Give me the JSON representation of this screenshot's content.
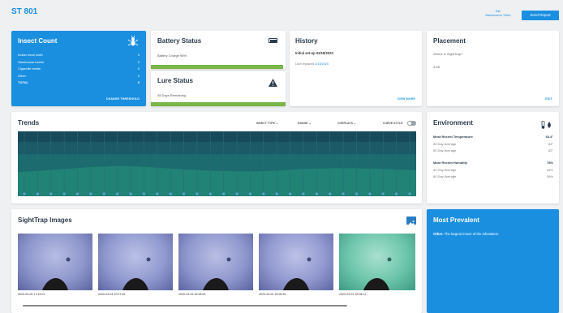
{
  "header": {
    "title": "ST 801",
    "edit_label": "Edit\nMaintenance Ticket",
    "report_label": "Send Report"
  },
  "insect_count": {
    "title": "Insect Count",
    "rows": [
      {
        "label": "Indian meal moth",
        "value": "0"
      },
      {
        "label": "Warehouse beetle",
        "value": "0"
      },
      {
        "label": "Cigarette beetle",
        "value": "0"
      },
      {
        "label": "Other",
        "value": "0"
      },
      {
        "label": "TOTAL",
        "value": "0"
      }
    ],
    "link": "CHANGE THRESHOLD"
  },
  "battery": {
    "title": "Battery Status",
    "text": "Battery Charge 98%",
    "level": 0.98
  },
  "lure": {
    "title": "Lure Status",
    "text": "45 Days Remaining",
    "level": 1.0
  },
  "history": {
    "title": "History",
    "entry_main": "Initial set-up 03/18/2020",
    "entry_sub": "Lure replaced",
    "entry_date": "3/18/2020",
    "link": "VIEW MORE"
  },
  "placement": {
    "title": "Placement",
    "question": "Where is SightTrap?",
    "value": "3-09",
    "link": "EDIT"
  },
  "trends": {
    "title": "Trends",
    "controls": [
      "INSECT TYPE",
      "RANGE",
      "OVERLAYS"
    ],
    "toggle_label": "CURVE STYLE",
    "colors": [
      "#174a5a",
      "#1c5a67",
      "#1c6b6e",
      "#208375"
    ]
  },
  "environment": {
    "title": "Environment",
    "temp_label": "Most Recent Temperature",
    "temp_value": "64.4°",
    "temp_rows": [
      {
        "label": "30 Day Average",
        "value": "64°"
      },
      {
        "label": "60 Day Average",
        "value": "62°"
      }
    ],
    "hum_label": "Most Recent Humidity",
    "hum_value": "78%",
    "hum_rows": [
      {
        "label": "30 Day Average",
        "value": "44%"
      },
      {
        "label": "60 Day Average",
        "value": "38%"
      }
    ]
  },
  "images": {
    "title": "SightTrap Images",
    "items": [
      {
        "caption": "2020-03-05 17:49:01"
      },
      {
        "caption": "2020-03-04 10:07:46"
      },
      {
        "caption": "2020-03-03 16:08:03"
      },
      {
        "caption": "2020-03-02 15:06:35"
      },
      {
        "caption": "2020-03-01 16:08:01"
      }
    ]
  },
  "prevalent": {
    "title": "Most Prevalent",
    "bold": "Other.",
    "text": " The largest insect of the infestation."
  }
}
